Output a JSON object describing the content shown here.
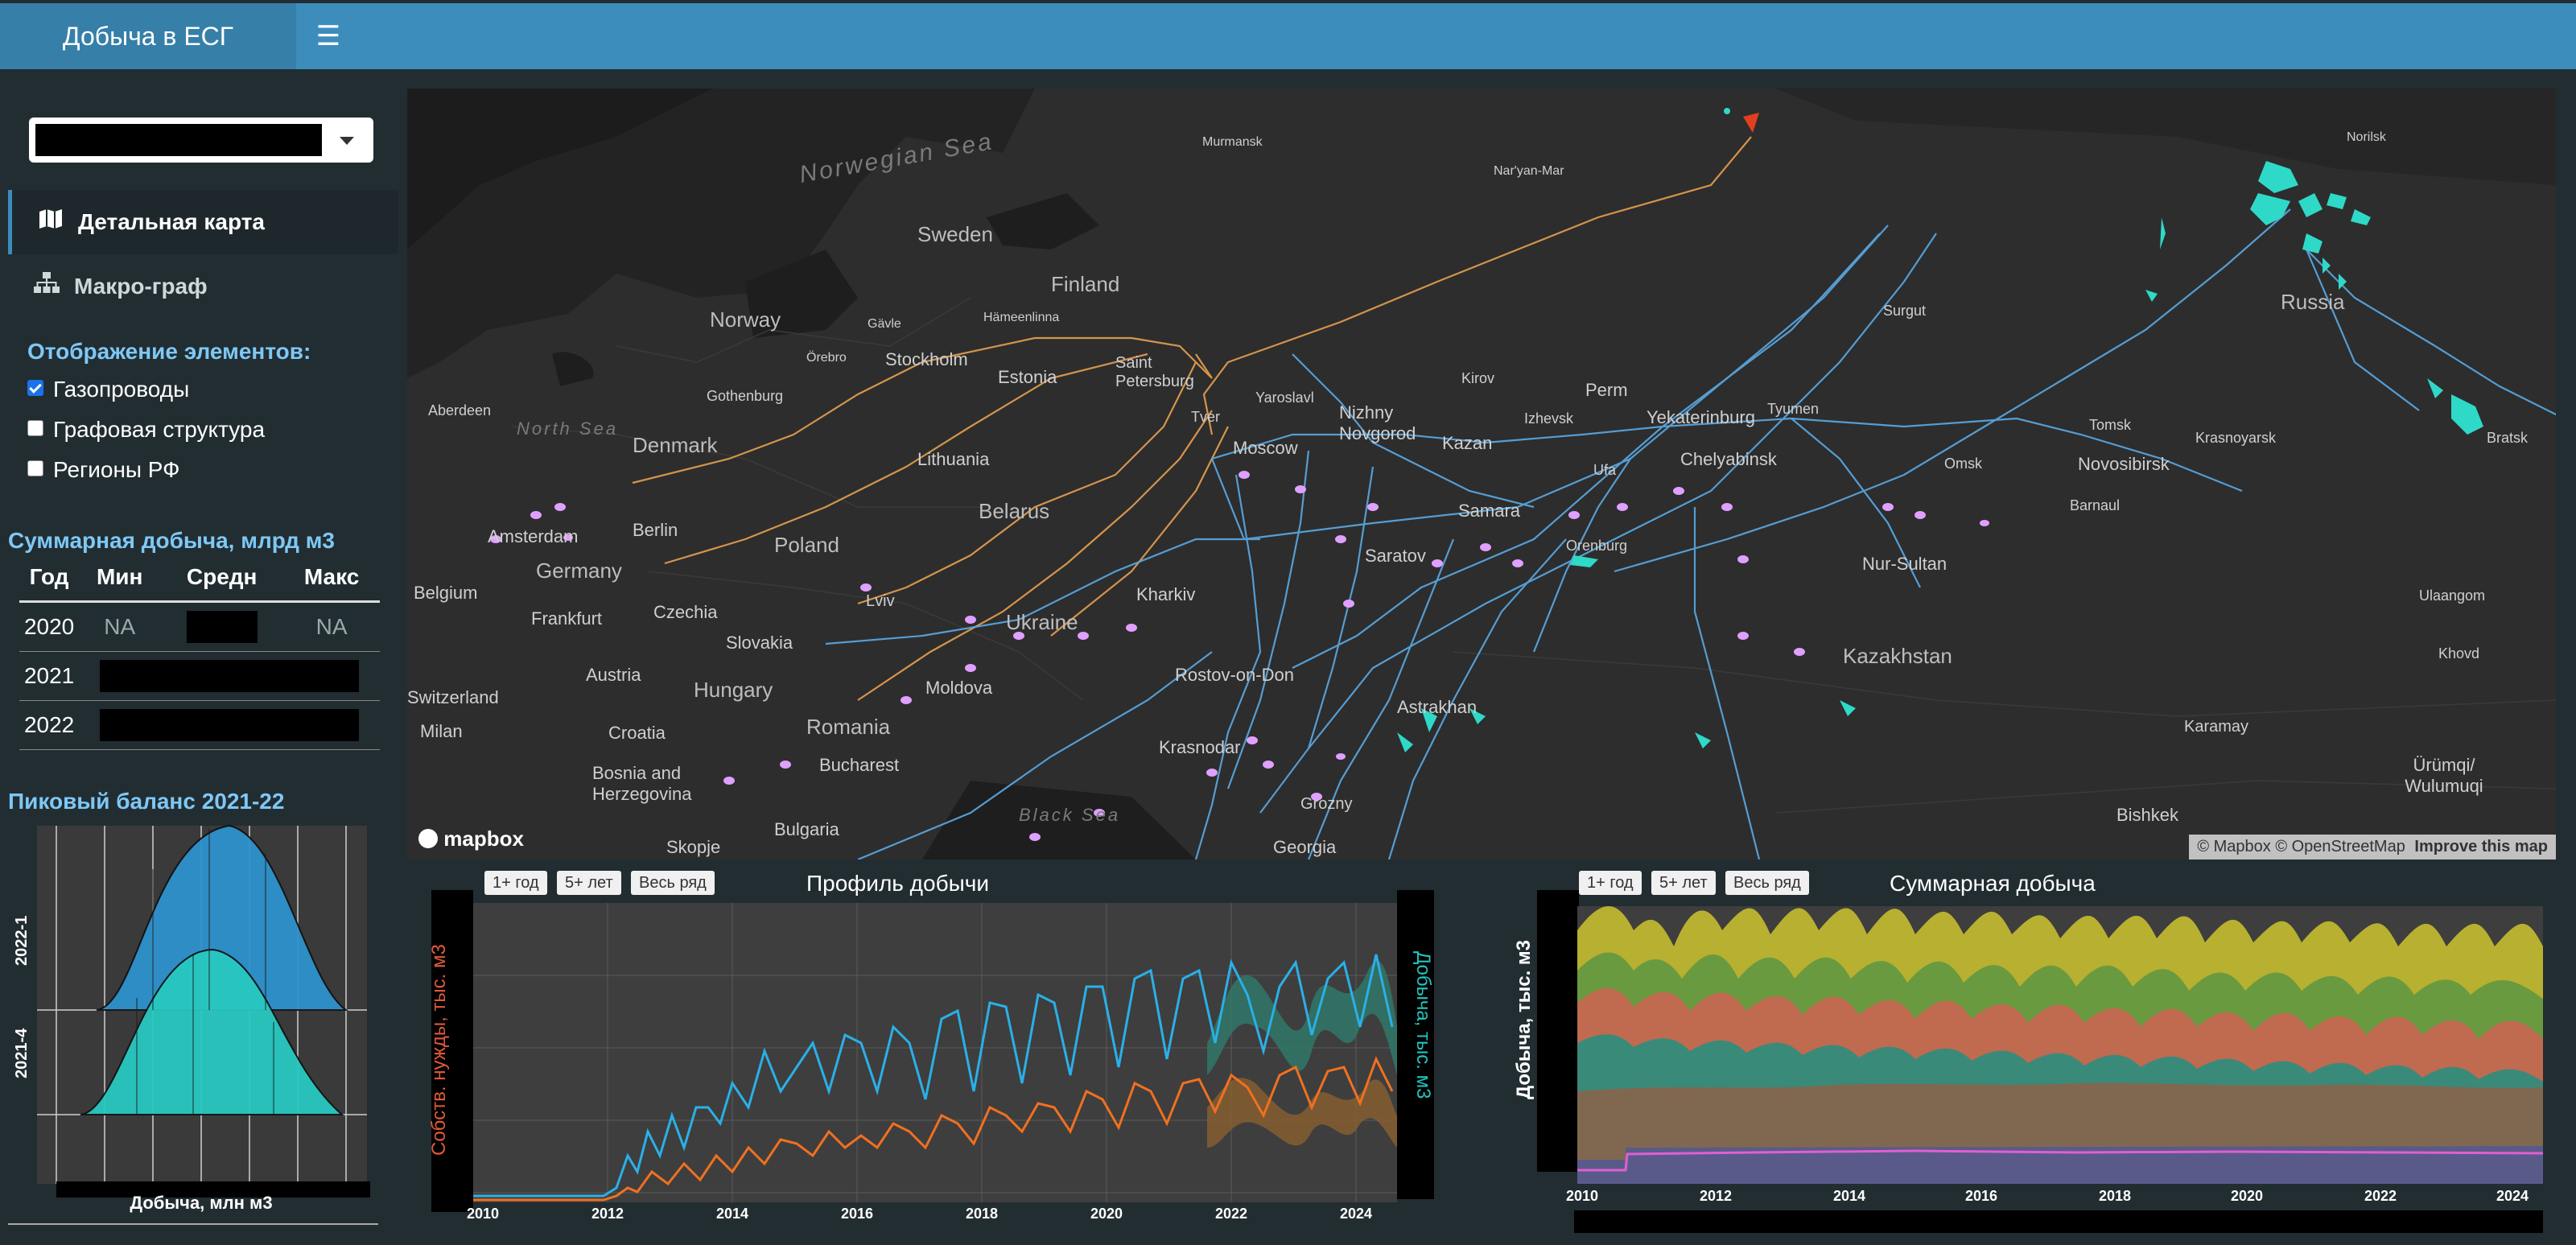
{
  "app": {
    "title": "Добыча в ЕСГ"
  },
  "sidebar": {
    "menu": [
      {
        "label": "Детальная карта",
        "icon": "map-icon"
      },
      {
        "label": "Макро-граф",
        "icon": "sitemap-icon"
      }
    ],
    "display_heading": "Отображение элементов:",
    "checkboxes": [
      {
        "label": "Газопроводы",
        "checked": true
      },
      {
        "label": "Графовая структура",
        "checked": false
      },
      {
        "label": "Регионы РФ",
        "checked": false
      }
    ],
    "summary_heading": "Суммарная добыча, млрд м3",
    "summary_table": {
      "headers": [
        "Год",
        "Мин",
        "Средн",
        "Макс"
      ],
      "rows": [
        {
          "year": "2020",
          "min": "NA",
          "max": "NA"
        },
        {
          "year": "2021"
        },
        {
          "year": "2022"
        }
      ]
    },
    "peak_heading": "Пиковый баланс 2021-22",
    "density": {
      "labels": [
        "2022-1",
        "2021-4"
      ],
      "xlabel": "Добыча, млн м3"
    }
  },
  "map": {
    "labels": {
      "norwegian_sea": "Norwegian Sea",
      "north_sea": "North Sea",
      "black_sea": "Black Sea",
      "sweden": "Sweden",
      "finland": "Finland",
      "norway": "Norway",
      "estonia": "Estonia",
      "denmark": "Denmark",
      "lithuania": "Lithuania",
      "belarus": "Belarus",
      "poland": "Poland",
      "germany": "Germany",
      "czechia": "Czechia",
      "slovakia": "Slovakia",
      "austria": "Austria",
      "hungary": "Hungary",
      "ukraine": "Ukraine",
      "moldova": "Moldova",
      "romania": "Romania",
      "croatia": "Croatia",
      "bosnia": "Bosnia and Herzegovina",
      "bulgaria": "Bulgaria",
      "switzerland": "Switzerland",
      "belgium": "Belgium",
      "russia": "Russia",
      "kazakhstan": "Kazakhstan",
      "georgia": "Georgia",
      "murmansk": "Murmansk",
      "naryan_mar": "Nar'yan-Mar",
      "norilsk": "Norilsk",
      "gavle": "Gävle",
      "hameenlinna": "Hämeenlinna",
      "orebro": "Örebro",
      "stockholm": "Stockholm",
      "gothenburg": "Gothenburg",
      "aberdeen": "Aberdeen",
      "saint_petersburg": "Saint Petersburg",
      "tver": "Tver",
      "yaroslavl": "Yaroslavl",
      "moscow": "Moscow",
      "nizhny": "Nizhny Novgorod",
      "kirov": "Kirov",
      "kazan": "Kazan",
      "izhevsk": "Izhevsk",
      "perm": "Perm",
      "yekaterinburg": "Yekaterinburg",
      "tyumen": "Tyumen",
      "surgut": "Surgut",
      "ufa": "Ufa",
      "chelyabinsk": "Chelyabinsk",
      "samara": "Samara",
      "orenburg": "Orenburg",
      "saratov": "Saratov",
      "omsk": "Omsk",
      "novosibirsk": "Novosibirsk",
      "tomsk": "Tomsk",
      "barnaul": "Barnaul",
      "krasnoyarsk": "Krasnoyarsk",
      "bratsk": "Bratsk",
      "nur_sultan": "Nur-Sultan",
      "ulaangom": "Ulaangom",
      "khovd": "Khovd",
      "karamay": "Karamay",
      "urumqi": "Ürümqi/ Wulumuqi",
      "bishkek": "Bishkek",
      "amsterdam": "Amsterdam",
      "berlin": "Berlin",
      "frankfurt": "Frankfurt",
      "milan": "Milan",
      "lviv": "Lviv",
      "kharkiv": "Kharkiv",
      "rostov": "Rostov-on-Don",
      "astrakhan": "Astrakhan",
      "krasnodar": "Krasnodar",
      "grozny": "Grozny",
      "bucharest": "Bucharest",
      "skopje": "Skopje"
    },
    "logo": "mapbox",
    "attribution": "© Mapbox © OpenStreetMap",
    "improve": "Improve this map",
    "colors": {
      "pipeline_import": "#e8a050",
      "pipeline_domestic": "#5aaae6",
      "field": "#2fd9c8",
      "consumer": "#e0a0ff"
    }
  },
  "profile_chart": {
    "title": "Профиль добычи",
    "range_buttons": [
      "1+ год",
      "5+ лет",
      "Весь ряд"
    ],
    "y_left_label": "Собств. нужды, тыс. м3",
    "y_right_label": "Добыча, тыс. м3",
    "x_ticks": [
      "2010",
      "2012",
      "2014",
      "2016",
      "2018",
      "2020",
      "2022",
      "2024"
    ],
    "series_colors": {
      "production": "#2ab0e8",
      "own_needs": "#f07020"
    }
  },
  "total_chart": {
    "title": "Суммарная добыча",
    "range_buttons": [
      "1+ год",
      "5+ лет",
      "Весь ряд"
    ],
    "y_label": "Добыча, тыс. м3",
    "x_ticks": [
      "2010",
      "2012",
      "2014",
      "2016",
      "2018",
      "2020",
      "2022",
      "2024"
    ],
    "area_colors": [
      "#c8c020",
      "#7aa040",
      "#d07050",
      "#3a9a8a",
      "#8a6a3a",
      "#5a5a8a",
      "#e060d0",
      "#5aa0c0"
    ]
  }
}
